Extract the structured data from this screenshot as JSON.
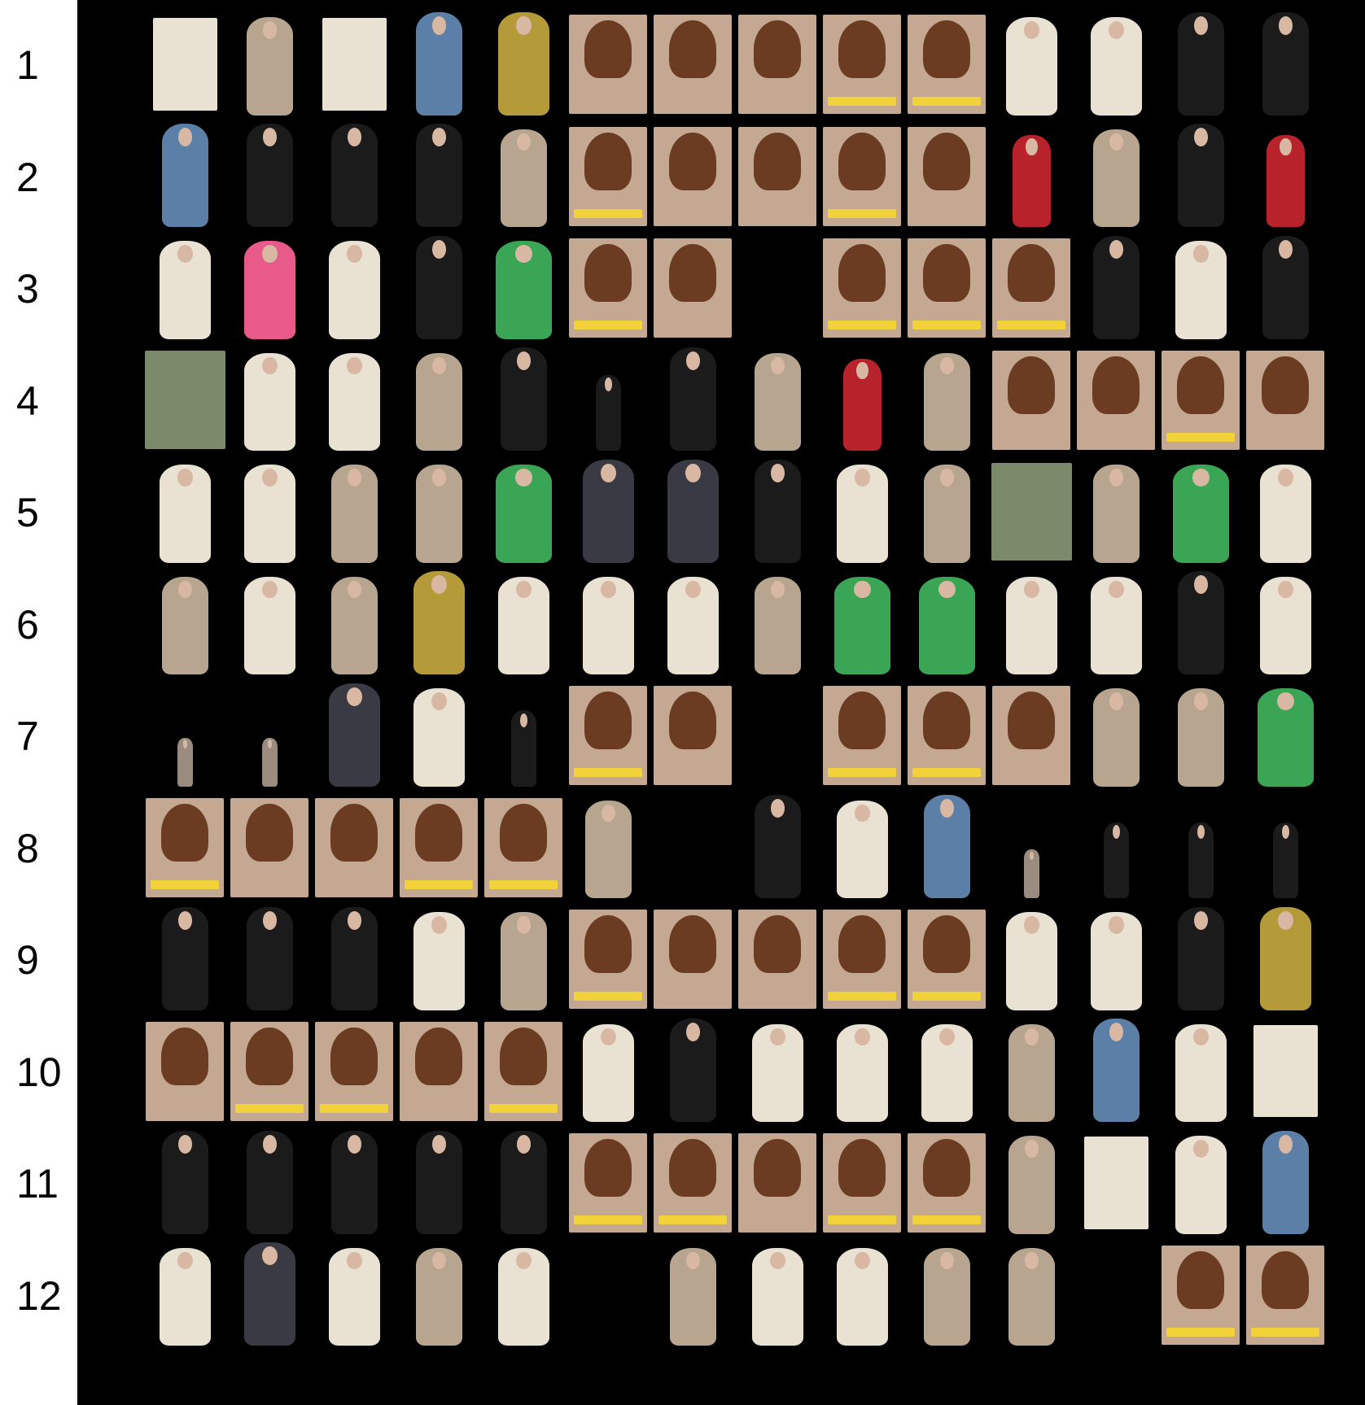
{
  "row_labels": [
    "1",
    "2",
    "3",
    "4",
    "5",
    "6",
    "7",
    "8",
    "9",
    "10",
    "11",
    "12"
  ],
  "columns_per_row": 14,
  "palette": {
    "background": "#000000",
    "label_background": "#ffffff",
    "label_text": "#000000",
    "hair": "#6b3b22",
    "skin": "#d9b8a3",
    "cream": "#e9e2d2",
    "black_outfit": "#1b1b1b",
    "denim": "#5b7fa6",
    "caption_yellow": "#f2d23a",
    "caption_green": "#3aa655",
    "pink": "#e85a8a",
    "red": "#b8222a",
    "grey": "#8a8a8a"
  },
  "rows": [
    [
      "tee-flatlay",
      "knit-skirt-set",
      "top-grid",
      "denim-crop",
      "yellow-dress-pair",
      "hair-bun",
      "hair-straight",
      "hair-bun",
      "hair-braid-caption",
      "hair-braid-caption",
      "grey-top-white-pants",
      "cream-top-bag",
      "black-long-dress",
      "black-top-pants"
    ],
    [
      "denim-shorts-pose",
      "black-outfit",
      "black-mini-dress",
      "black-top-bag",
      "khaki-jacket",
      "hair-braid-caption",
      "hair-bun-pair",
      "hair-hold",
      "hair-short-caption",
      "hair-bun",
      "red-hanfu",
      "plaid-coat",
      "hanfu-black-gold",
      "red-hanfu"
    ],
    [
      "cream-blouse",
      "zero-box",
      "lace-collar",
      "black-cape",
      "green-tank",
      "hair-short-caption",
      "hair-braid-hold",
      "empty",
      "hair-braid-caption",
      "hair-clip-caption",
      "hair-bun-caption",
      "black-outfit",
      "white-top-pants",
      "black-top-pants"
    ],
    [
      "skincare-products",
      "cream-blouse",
      "cream-blouse",
      "lavender-scarf",
      "black-cape",
      "black-dress-small",
      "hanfu-black-gold",
      "plaid-coat",
      "red-coat",
      "beige-coat",
      "hair-hold",
      "hair-bun",
      "hair-caption-raglan",
      "hair-hold"
    ],
    [
      "cream-blouse",
      "cream-blouse",
      "lavender-scarf",
      "scarf-cap",
      "green-bottle",
      "grey-cape",
      "dark-hanfu",
      "hanfu-black-gold",
      "white-hanfu",
      "navy-dress",
      "beanie-collage",
      "striped-cardigan",
      "green-collage",
      "cream-hat-tee"
    ],
    [
      "lavender-tank",
      "white-tee-skirt",
      "burgundy-top",
      "olive-dress",
      "white-dress",
      "lace-collar",
      "cream-scarf",
      "scarf-cap",
      "green-tank",
      "green-bottle",
      "white-cardigan-jeans",
      "grey-top-white-pants",
      "black-jacket",
      "cream-top-bag"
    ],
    [
      "tiny-figure",
      "tiny-figure",
      "grey-outfit",
      "white-jacket",
      "black-outfit-small",
      "hair-caption-raglan",
      "hair-straight",
      "empty",
      "hair-bun-caption",
      "hair-clip-caption",
      "hair-hold",
      "scarf-cap",
      "lavender-scarf",
      "green-tank"
    ],
    [
      "hair-bun-caption",
      "hair-bun",
      "hair-hold",
      "hair-braid-caption",
      "hair-braid-caption",
      "street-trio",
      "empty",
      "black-jacket",
      "white-tee-jeans",
      "grey-jeans",
      "tiny-figure",
      "black-dress-small",
      "white-dress-small",
      "couple-small"
    ],
    [
      "black-outfit",
      "black-outfit",
      "black-outfit",
      "cream-top-bag",
      "khaki-jacket",
      "hair-short-caption",
      "hair-hold",
      "hair-braid-hold",
      "hair-bun-caption",
      "hair-braid-caption",
      "white-dancer",
      "white-crop-jeans",
      "black-floral",
      "gold-floral-dress"
    ],
    [
      "hair-hold",
      "hair-braid-caption",
      "hair-braid-caption",
      "hair-bun",
      "hair-bun-caption",
      "white-top-pants",
      "black-long-dress",
      "white-top-jeans",
      "cream-top-bag",
      "white-top-jeans",
      "knit-skirt-set",
      "denim-crop",
      "cream-mini",
      "top-grid"
    ],
    [
      "black-outfit",
      "black-offshoulder",
      "black-corset",
      "black-long-dress",
      "black-outfit",
      "hair-bun-caption",
      "hair-caption-raglan",
      "hair-straight",
      "hair-braid-caption",
      "hair-braid-caption",
      "plaid-shirt",
      "tee-flatlay",
      "cream-mini",
      "denim-crop"
    ],
    [
      "pink-lace-dress",
      "grey-hoodie",
      "white-mini-pair",
      "houndstooth-bag",
      "cream-cardigan",
      "empty",
      "fur-coat-pose",
      "white-crop-sit",
      "white-long",
      "plaid-shirt-crop",
      "portrait-closeup",
      "empty",
      "hair-caption-raglan",
      "hair-braid-caption"
    ]
  ]
}
